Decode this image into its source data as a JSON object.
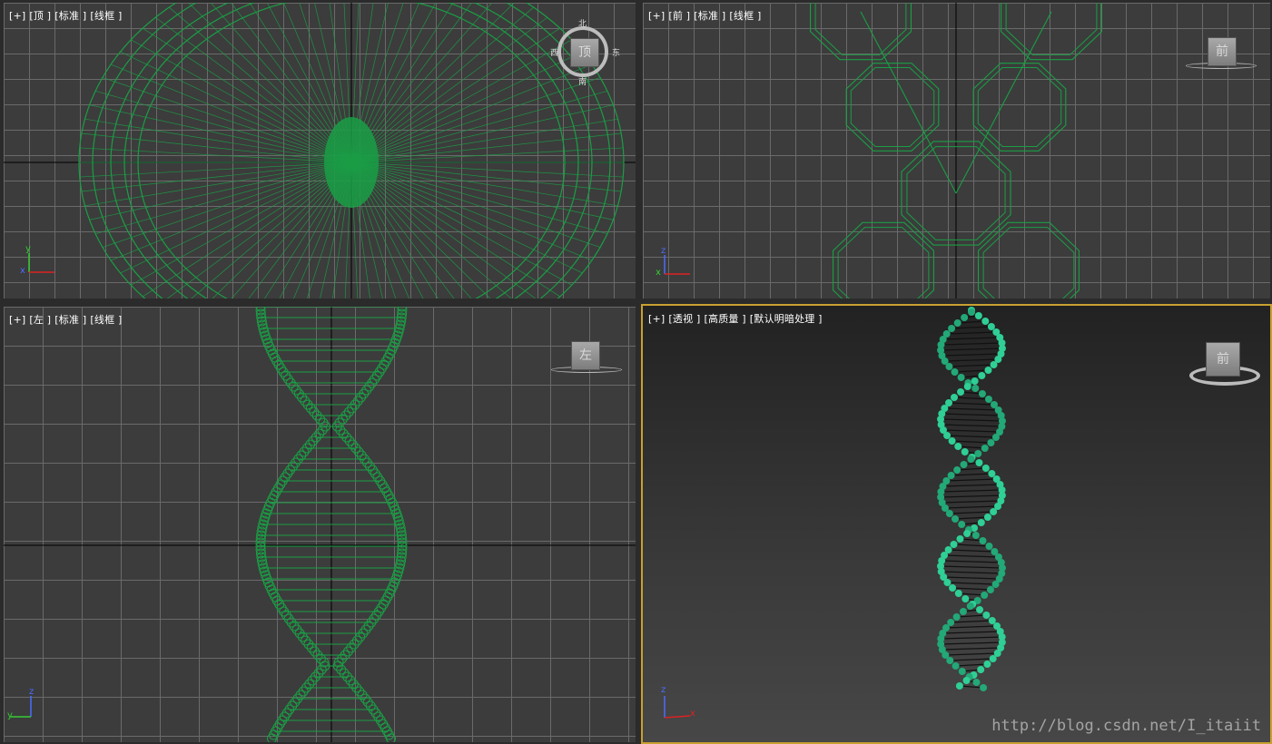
{
  "viewports": {
    "top": {
      "labels": [
        "[+]",
        "[顶 ]",
        "[标准 ]",
        "[线框 ]"
      ],
      "compass": {
        "n": "北",
        "s": "南",
        "e": "东",
        "w": "西",
        "cube": "顶"
      },
      "axes": {
        "a": "y",
        "b": "x"
      }
    },
    "front": {
      "labels": [
        "[+]",
        "[前 ]",
        "[标准 ]",
        "[线框 ]"
      ],
      "cube": "前",
      "axes": {
        "a": "z",
        "b": "x"
      }
    },
    "left": {
      "labels": [
        "[+]",
        "[左 ]",
        "[标准 ]",
        "[线框 ]"
      ],
      "cube": "左",
      "axes": {
        "a": "z",
        "b": "y"
      }
    },
    "perspective": {
      "labels": [
        "[+]",
        "[透视 ]",
        "[高质量 ]",
        "[默认明暗处理 ]"
      ],
      "cube": "前",
      "axes": {
        "a": "z",
        "b": "x"
      }
    }
  },
  "watermark": "http://blog.csdn.net/I_itaiit",
  "colors": {
    "wire": "#1a9e45",
    "model": "#2fcf96",
    "active_border": "#c8a030",
    "grid": "#6a6a6a"
  }
}
